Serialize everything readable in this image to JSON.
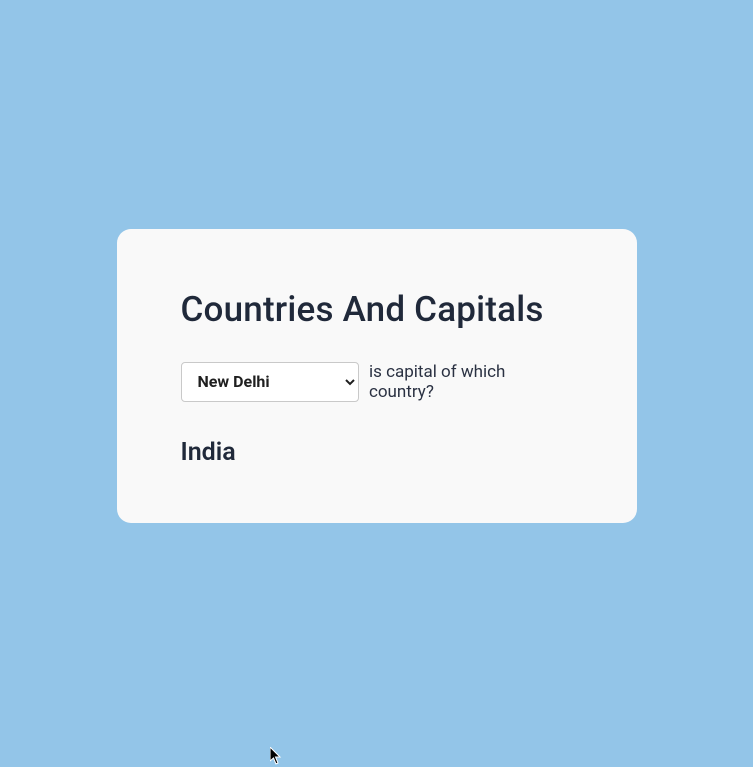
{
  "card": {
    "title": "Countries And Capitals",
    "select": {
      "selected": "New Delhi"
    },
    "question_suffix": "is capital of which country?",
    "answer": "India"
  }
}
